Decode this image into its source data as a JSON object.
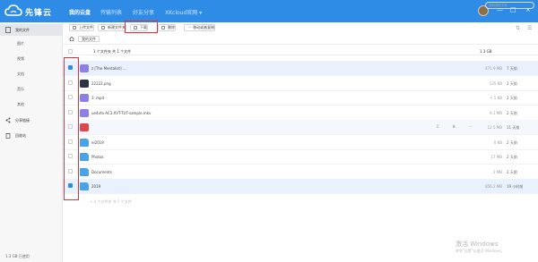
{
  "app": {
    "brand": "先锋云"
  },
  "nav": [
    {
      "label": "我的云盘",
      "active": true
    },
    {
      "label": "传输列表",
      "active": false
    },
    {
      "label": "好友分享",
      "active": false
    },
    {
      "label": "XKcloud官网 ▾",
      "active": false
    }
  ],
  "window_controls": [
    "—",
    "□",
    "×"
  ],
  "sidebar": {
    "my_files": "我的文件",
    "sub": [
      "图片",
      "视频",
      "文档",
      "音乐",
      "其他"
    ],
    "share": "分享链接",
    "recycle": "回收站",
    "quota": "1.3 GB 已使用"
  },
  "toolbar": {
    "upload": "上传文件",
    "new_folder": "新建文件夹",
    "download": "下载",
    "delete": "删除",
    "more": "··· 移动或者复制"
  },
  "path": {
    "crumb": "我的文件",
    "search_placeholder": "搜索我的文件"
  },
  "list": {
    "count": "1 个文件夹 共 1 个文件",
    "total_size": "1.3 GB",
    "rows": [
      {
        "name": "z        [The Mentalist] ...",
        "size": "471.9 MB",
        "date": "7 天前",
        "icon": "video-icon",
        "color": "#8d7ee8",
        "selected": true
      },
      {
        "name": "22222.png",
        "size": "135 KB",
        "date": "2 天前",
        "icon": "image-file-icon",
        "color": "#2b3440",
        "selected": false
      },
      {
        "name": "3 .mp4",
        "size": "< 1 KB",
        "date": "2 天前",
        "icon": "video-icon",
        "color": "#8d7ee8",
        "selected": false
      },
      {
        "name": "                    ue4vto AC3.XVT-TUT-sample.mkv",
        "size": "9.1 MB",
        "date": "2 天前",
        "icon": "video-icon",
        "color": "#8d7ee8",
        "selected": false
      },
      {
        "name": "",
        "size": "12.5 MB",
        "date": "11 天前",
        "icon": "pdf-icon",
        "color": "#e0474c",
        "selected": false,
        "hover": true
      },
      {
        "name": "el2019",
        "size": "0 KB",
        "date": "2 天前",
        "icon": "folder-icon",
        "color": "#4aa3ea",
        "selected": false
      },
      {
        "name": "Photos",
        "size": "17 MB",
        "date": "2 天前",
        "icon": "folder-icon",
        "color": "#4aa3ea",
        "selected": false
      },
      {
        "name": "Documents",
        "size": "2 MB",
        "date": "2 天前",
        "icon": "folder-icon",
        "color": "#4aa3ea",
        "selected": false
      },
      {
        "name": "2019",
        "size": "856.2 MB",
        "date": "19 小时前",
        "icon": "folder-icon",
        "color": "#4aa3ea",
        "selected": true
      }
    ],
    "more": "+ 4 个文件夹 共 5 个文件"
  },
  "watermark": {
    "title": "激活 Windows",
    "sub": "转到\"设置\"以激活 Windows。"
  }
}
